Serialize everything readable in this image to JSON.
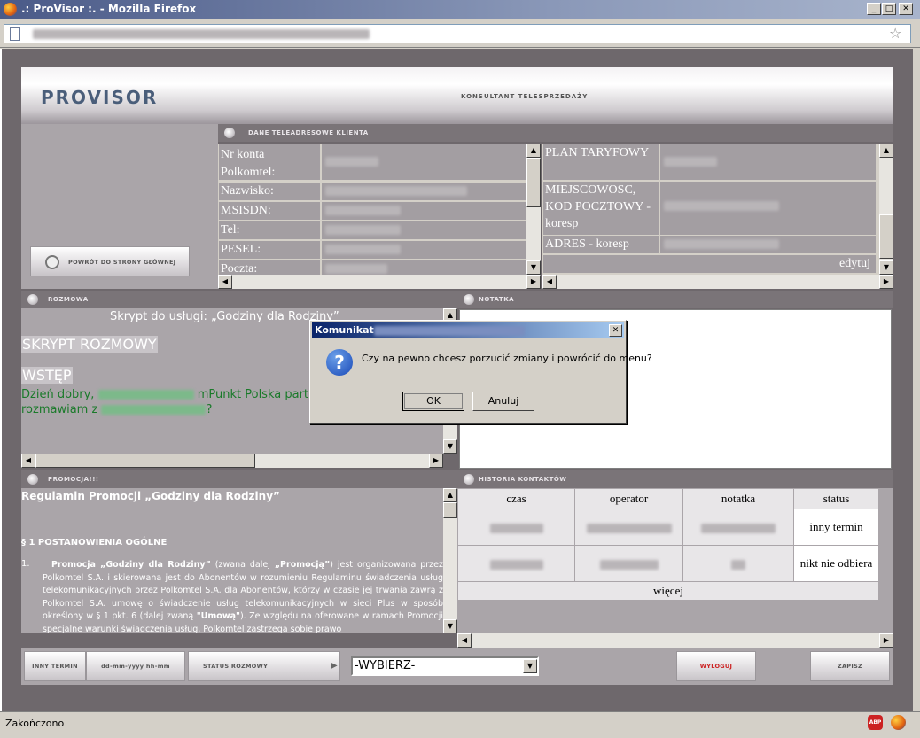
{
  "browser": {
    "title": ".: ProVisor :. - Mozilla Firefox",
    "status": "Zakończono",
    "abp": "ABP"
  },
  "app": {
    "logo": "PROVISOR",
    "subtitle": "KONSULTANT TELESPRZEDAŻY",
    "home_button": "POWRÓT DO STRONY GŁÓWNEJ"
  },
  "client": {
    "header": "DANE TELEADRESOWE KLIENTA",
    "fields_left": [
      "Nr konta Polkomtel:",
      "Nazwisko:",
      "MSISDN:",
      "Tel:",
      "PESEL:",
      "Poczta:"
    ],
    "fields_right": [
      "PLAN TARYFOWY",
      "MIEJSCOWOSC, KOD POCZTOWY - koresp",
      "ADRES - koresp"
    ],
    "edit": "edytuj"
  },
  "conversation": {
    "header": "ROZMOWA",
    "script_title": "Skrypt do usługi: „Godziny dla Rodziny”",
    "heading": "SKRYPT ROZMOWY",
    "subheading": "WSTĘP",
    "greeting_a": "Dzień dobry,",
    "greeting_b": "mPunkt Polska part",
    "greeting_c": "rozmawiam z",
    "greeting_d": "?"
  },
  "note": {
    "header": "NOTATKA"
  },
  "promo": {
    "header": "PROMOCJA!!!",
    "title": "Regulamin Promocji „Godziny dla Rodziny”",
    "section": "§ 1 POSTANOWIENIA OGÓLNE",
    "num": "1.",
    "p_bold1": "Promocja „Godziny dla Rodziny”",
    "p_t1": " (zwana dalej ",
    "p_bold2": "„Promocją”",
    "p_t2": ") jest organizowana przez Polkomtel S.A. i skierowana jest do Abonentów w rozumieniu Regulaminu świadczenia usług telekomunikacyjnych przez Polkomtel S.A. dla Abonentów, którzy w czasie jej trwania zawrą z Polkomtel S.A. umowę o świadczenie usług telekomunikacyjnych w sieci Plus w sposób określony w § 1 pkt. 6 (dalej zwaną ",
    "p_bold3": "\"Umową\"",
    "p_t3": "). Ze względu na oferowane w ramach Promocji specjalne warunki świadczenia usług, Polkomtel zastrzega sobie prawo"
  },
  "history": {
    "header": "HISTORIA KONTAKTÓW",
    "columns": [
      "czas",
      "operator",
      "notatka",
      "status"
    ],
    "statuses": [
      "inny termin",
      "nikt nie odbiera"
    ],
    "more": "więcej"
  },
  "bottom": {
    "other_term": "INNY TERMIN",
    "date_hint": "dd-mm-yyyy hh-mm",
    "call_status": "STATUS ROZMOWY",
    "select_value": "-WYBIERZ-",
    "logout": "WYLOGUJ",
    "save": "ZAPISZ"
  },
  "dialog": {
    "title": "Komunikat",
    "message": "Czy na pewno chcesz porzucić zmiany i powrócić do menu?",
    "ok": "OK",
    "cancel": "Anuluj"
  },
  "colors": {
    "frame": "#6e686c",
    "accent_red": "#cc2222",
    "dialog_title": "#0a246a"
  }
}
